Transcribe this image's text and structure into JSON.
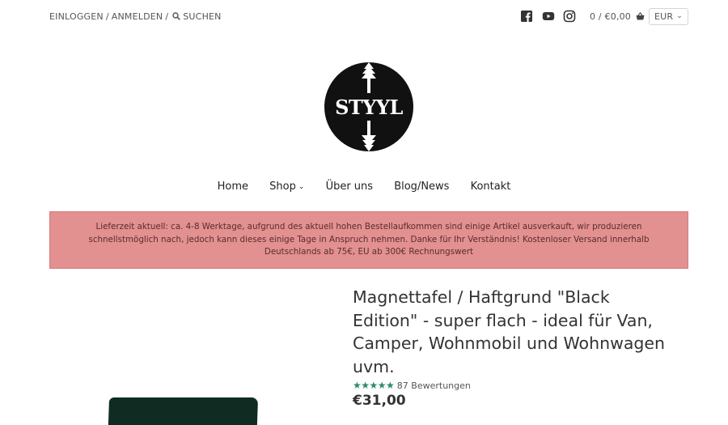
{
  "topbar": {
    "login": "EINLOGGEN",
    "separator": "/",
    "register": "ANMELDEN",
    "search": "SUCHEN",
    "cart": "0 / €0,00",
    "currency": "EUR"
  },
  "social": [
    "facebook-icon",
    "youtube-icon",
    "instagram-icon"
  ],
  "logo": {
    "text": "STYYL"
  },
  "nav": {
    "home": "Home",
    "shop": "Shop",
    "about": "Über uns",
    "blog": "Blog/News",
    "contact": "Kontakt"
  },
  "notice": {
    "text": "Lieferzeit aktuell: ca. 4-8 Werktage, aufgrund des aktuell hohen Bestellaufkommen sind einige Artikel ausverkauft, wir produzieren schnellstmöglich nach, jedoch kann dieses einige Tage in Anspruch nehmen. Danke für Ihr Verständnis! Kostenloser Versand innerhalb Deutschlands ab 75€, EU ab 300€ Rechnungswert"
  },
  "product": {
    "title": "Magnettafel / Haftgrund \"Black Edition\" - super flach - ideal für Van, Camper, Wohnmobil und Wohnwagen uvm.",
    "stars": "★★★★★",
    "rating": 5,
    "reviews": "87 Bewertungen",
    "price": "€31,00"
  },
  "colors": {
    "notice_bg": "#e29090",
    "star": "#2e8a72",
    "board": "#102b22"
  }
}
